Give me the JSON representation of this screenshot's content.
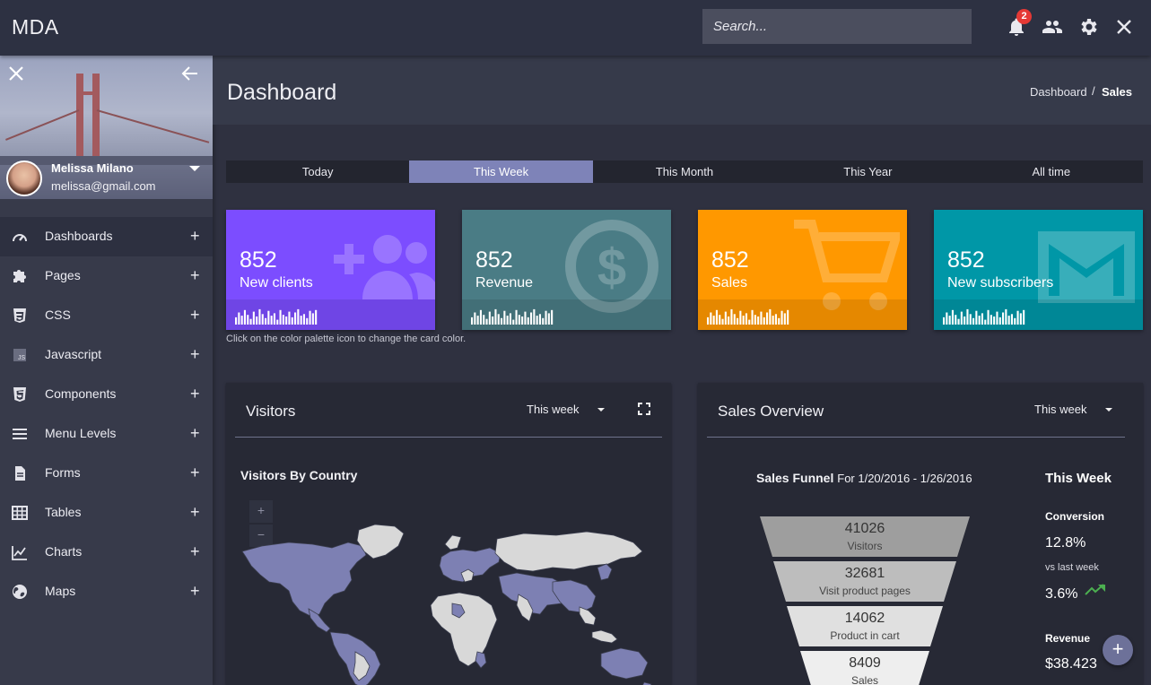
{
  "app": {
    "brand": "MDA"
  },
  "header": {
    "search_placeholder": "Search...",
    "notification_count": "2",
    "icons": [
      "bell-icon",
      "people-icon",
      "gear-icon",
      "close-icon"
    ]
  },
  "profile": {
    "name": "Melissa Milano",
    "email": "melissa@gmail.com"
  },
  "sidebar": {
    "items": [
      {
        "label": "Dashboards",
        "icon": "speedometer-icon",
        "active": true
      },
      {
        "label": "Pages",
        "icon": "puzzle-icon"
      },
      {
        "label": "CSS",
        "icon": "css3-icon"
      },
      {
        "label": "Javascript",
        "icon": "js-icon"
      },
      {
        "label": "Components",
        "icon": "html5-icon"
      },
      {
        "label": "Menu Levels",
        "icon": "menu-icon"
      },
      {
        "label": "Forms",
        "icon": "document-icon"
      },
      {
        "label": "Tables",
        "icon": "table-icon"
      },
      {
        "label": "Charts",
        "icon": "line-chart-icon"
      },
      {
        "label": "Maps",
        "icon": "globe-icon"
      }
    ],
    "expand_symbol": "+"
  },
  "page": {
    "title": "Dashboard",
    "breadcrumb": [
      "Dashboard",
      "/",
      "Sales"
    ]
  },
  "tabs": [
    {
      "label": "Today"
    },
    {
      "label": "This Week",
      "active": true
    },
    {
      "label": "This Month"
    },
    {
      "label": "This Year"
    },
    {
      "label": "All time"
    }
  ],
  "cards": [
    {
      "value": "852",
      "label": "New clients",
      "color": "#7c4dff",
      "icon": "add-group-icon"
    },
    {
      "value": "852",
      "label": "Revenue",
      "color": "#4a7c85",
      "icon": "dollar-icon"
    },
    {
      "value": "852",
      "label": "Sales",
      "color": "#ff9800",
      "icon": "cart-icon"
    },
    {
      "value": "852",
      "label": "New subscribers",
      "color": "#0097a7",
      "icon": "mail-icon"
    }
  ],
  "cards_hint": "Click on the color palette icon to change the card color.",
  "visitors": {
    "title": "Visitors",
    "range": "This week",
    "map_title": "Visitors By Country",
    "zoom_in": "+",
    "zoom_out": "−"
  },
  "sales": {
    "title": "Sales Overview",
    "range": "This week",
    "funnel_title": "Sales Funnel",
    "funnel_period": "For 1/20/2016 - 1/26/2016",
    "funnel": [
      {
        "value": "41026",
        "label": "Visitors"
      },
      {
        "value": "32681",
        "label": "Visit product pages"
      },
      {
        "value": "14062",
        "label": "Product in cart"
      },
      {
        "value": "8409",
        "label": "Sales"
      }
    ],
    "summary_title": "This Week",
    "conversion_label": "Conversion",
    "conversion_value": "12.8%",
    "vs_label": "vs last week",
    "vs_value": "3.6%",
    "revenue_label": "Revenue",
    "revenue_value": "$38.423"
  },
  "fab": "+"
}
